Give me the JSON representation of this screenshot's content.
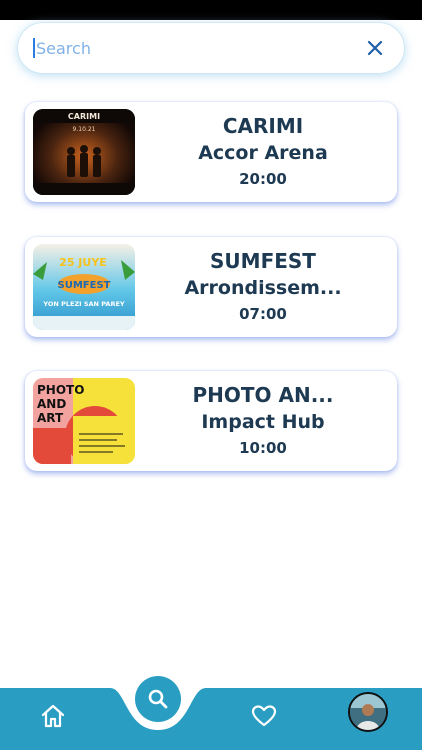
{
  "search": {
    "placeholder": "Search",
    "value": ""
  },
  "events": [
    {
      "title": "CARIMI",
      "venue": "Accor Arena",
      "time": "20:00",
      "poster_text": "CARIMI",
      "poster_date": "9.10.21"
    },
    {
      "title": "SUMFEST",
      "venue": "Arrondissem...",
      "time": "07:00",
      "poster_text": "25 JUYE",
      "poster_sub": "YON PLEZI SAN PAREY"
    },
    {
      "title": "PHOTO AN...",
      "venue": "Impact Hub",
      "time": "10:00",
      "poster_text": "PHOTO AND ART"
    }
  ],
  "nav": {
    "items": [
      "home-icon",
      "search-icon",
      "heart-icon",
      "avatar"
    ]
  },
  "colors": {
    "accent": "#2a9ec2",
    "text": "#1e3a52",
    "placeholder": "#7fb2e6"
  }
}
